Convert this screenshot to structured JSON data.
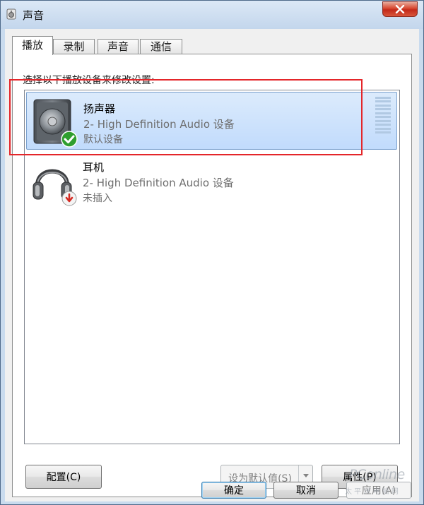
{
  "window": {
    "title": "声音",
    "title_icon": "speaker-icon"
  },
  "tabs": [
    {
      "label": "播放",
      "active": true
    },
    {
      "label": "录制",
      "active": false
    },
    {
      "label": "声音",
      "active": false
    },
    {
      "label": "通信",
      "active": false
    }
  ],
  "playback": {
    "instruction": "选择以下播放设备来修改设置:",
    "devices": [
      {
        "name": "扬声器",
        "driver": "2- High Definition Audio 设备",
        "status": "默认设备",
        "icon": "speaker-icon",
        "badge": "check-icon",
        "selected": true
      },
      {
        "name": "耳机",
        "driver": "2- High Definition Audio 设备",
        "status": "未插入",
        "icon": "headphones-icon",
        "badge": "unplugged-icon",
        "selected": false
      }
    ]
  },
  "buttons": {
    "configure": "配置(C)",
    "set_default": "设为默认值(S)",
    "properties": "属性(P)",
    "ok": "确定",
    "cancel": "取消",
    "apply": "应用(A)"
  },
  "watermark": {
    "logo": "PConline",
    "sub": "太 平 洋 电 脑 网"
  },
  "colors": {
    "selection": "#c1dbfc",
    "highlight_box": "#e4262a",
    "close_button": "#c3291a"
  }
}
